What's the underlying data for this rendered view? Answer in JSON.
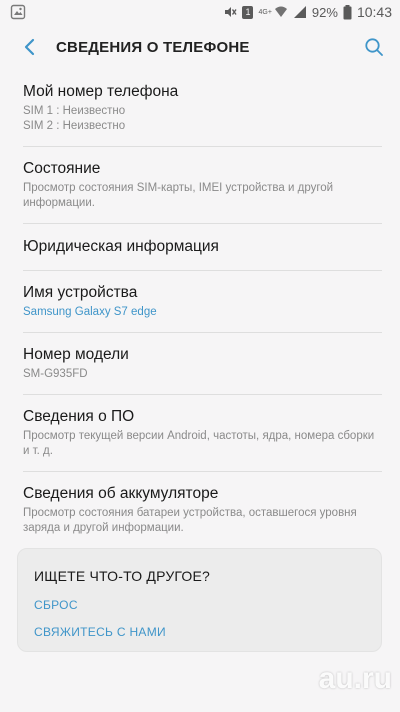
{
  "status_bar": {
    "network": "4G+",
    "sim_badge": "1",
    "battery_percent": "92%",
    "time": "10:43"
  },
  "app_bar": {
    "title": "СВЕДЕНИЯ О ТЕЛЕФОНЕ"
  },
  "items": [
    {
      "title": "Мой номер телефона",
      "subs": [
        "SIM 1 : Неизвестно",
        "SIM 2 : Неизвестно"
      ]
    },
    {
      "title": "Состояние",
      "subs": [
        "Просмотр состояния SIM-карты, IMEI устройства и другой информации."
      ]
    },
    {
      "title": "Юридическая информация",
      "subs": []
    },
    {
      "title": "Имя устройства",
      "subs": [
        "Samsung Galaxy S7 edge"
      ],
      "accent": true
    },
    {
      "title": "Номер модели",
      "subs": [
        "SM-G935FD"
      ]
    },
    {
      "title": "Сведения о ПО",
      "subs": [
        "Просмотр текущей версии Android, частоты, ядра, номера сборки и т. д."
      ]
    },
    {
      "title": "Сведения об аккумуляторе",
      "subs": [
        "Просмотр состояния батареи устройства, оставшегося уровня заряда и другой информации."
      ]
    }
  ],
  "help_card": {
    "title": "ИЩЕТЕ ЧТО-ТО ДРУГОЕ?",
    "link_reset": "СБРОС",
    "link_contact": "СВЯЖИТЕСЬ С НАМИ"
  },
  "watermark": {
    "brand": "au.ru"
  },
  "colors": {
    "accent": "#3f95c9",
    "background": "#f6f5f6"
  }
}
